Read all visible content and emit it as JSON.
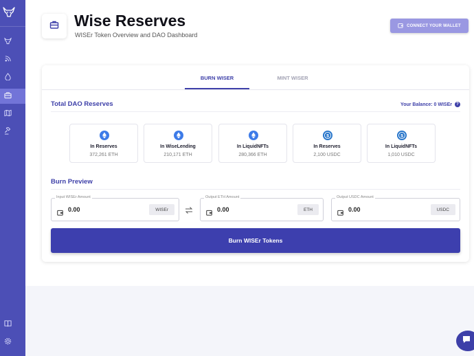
{
  "colors": {
    "sidebar": "#4c4fb6",
    "sidebar_active": "#7274d8",
    "primary": "#3d3fae",
    "connect_button": "#9a98e2",
    "eth_blue": "#3d7be8",
    "usdc_blue": "#2775ca"
  },
  "sidebar": {
    "items": [
      {
        "icon": "bull-icon"
      },
      {
        "icon": "signal-icon"
      },
      {
        "icon": "droplet-icon"
      },
      {
        "icon": "briefcase-icon",
        "active": true
      },
      {
        "icon": "map-icon"
      },
      {
        "icon": "gavel-icon"
      }
    ],
    "bottom_items": [
      {
        "icon": "book-icon"
      },
      {
        "icon": "gear-icon"
      }
    ]
  },
  "header": {
    "title": "Wise Reserves",
    "subtitle": "WISEr Token Overview and DAO Dashboard",
    "icon": "briefcase-icon",
    "connect_label": "CONNECT YOUR WALLET"
  },
  "tabs": [
    {
      "label": "BURN WISER",
      "active": true
    },
    {
      "label": "MINT WISER",
      "active": false
    }
  ],
  "reserves": {
    "title": "Total DAO Reserves",
    "balance": "Your Balance: 0 WISEr",
    "help": "?",
    "cards": [
      {
        "icon": "eth-icon",
        "label": "In Reserves",
        "value": "372,261 ETH"
      },
      {
        "icon": "eth-icon",
        "label": "In WiseLending",
        "value": "210,171 ETH"
      },
      {
        "icon": "eth-icon",
        "label": "In LiquidNFTs",
        "value": "280,366 ETH"
      },
      {
        "icon": "usdc-icon",
        "label": "In Reserves",
        "value": "2,100 USDC"
      },
      {
        "icon": "usdc-icon",
        "label": "In LiquidNFTs",
        "value": "1,010 USDC"
      }
    ]
  },
  "burn_preview": {
    "title": "Burn Preview",
    "fields": [
      {
        "legend": "Input WISEr Amount",
        "value": "0.00",
        "unit": "WISEr"
      },
      {
        "legend": "Output ETH Amount",
        "value": "0.00",
        "unit": "ETH"
      },
      {
        "legend": "Output USDC Amount",
        "value": "0.00",
        "unit": "USDC"
      }
    ],
    "button_label": "Burn WISEr Tokens"
  }
}
